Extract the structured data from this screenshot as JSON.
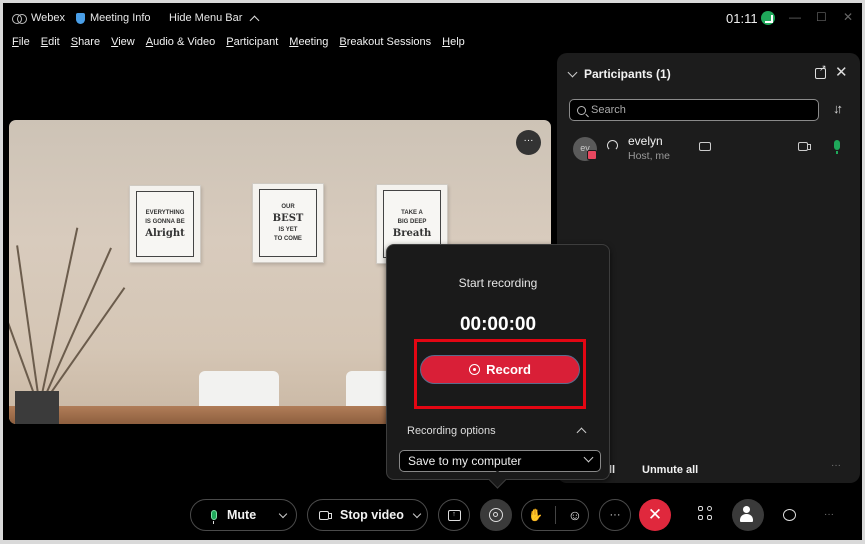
{
  "titlebar": {
    "app_name": "Webex",
    "meeting_info": "Meeting Info",
    "hide_menu_bar": "Hide Menu Bar",
    "clock": "01:11",
    "minimize": "—",
    "maximize": "☐",
    "close": "✕"
  },
  "menu": [
    "File",
    "Edit",
    "Share",
    "View",
    "Audio & Video",
    "Participant",
    "Meeting",
    "Breakout Sessions",
    "Help"
  ],
  "video": {
    "more_label": "···"
  },
  "participants": {
    "title": "Participants (1)",
    "search_placeholder": "Search",
    "list": [
      {
        "initials": "ev",
        "name": "evelyn",
        "role": "Host, me",
        "mic_color": "#1fa85a"
      }
    ],
    "mute_all": "Mute all",
    "mute_all_visible": "ll",
    "unmute_all": "Unmute all",
    "more": "···"
  },
  "recording": {
    "title": "Start recording",
    "timer": "00:00:00",
    "record_button": "Record",
    "options_label": "Recording options",
    "save_option": "Save to my computer",
    "button_color": "#d91f37",
    "highlight_color": "#e30613"
  },
  "toolbar": {
    "mute": "Mute",
    "stop_video": "Stop video",
    "more": "···",
    "end_call": "✕",
    "more_right": "···",
    "end_call_color": "#e0283d"
  }
}
